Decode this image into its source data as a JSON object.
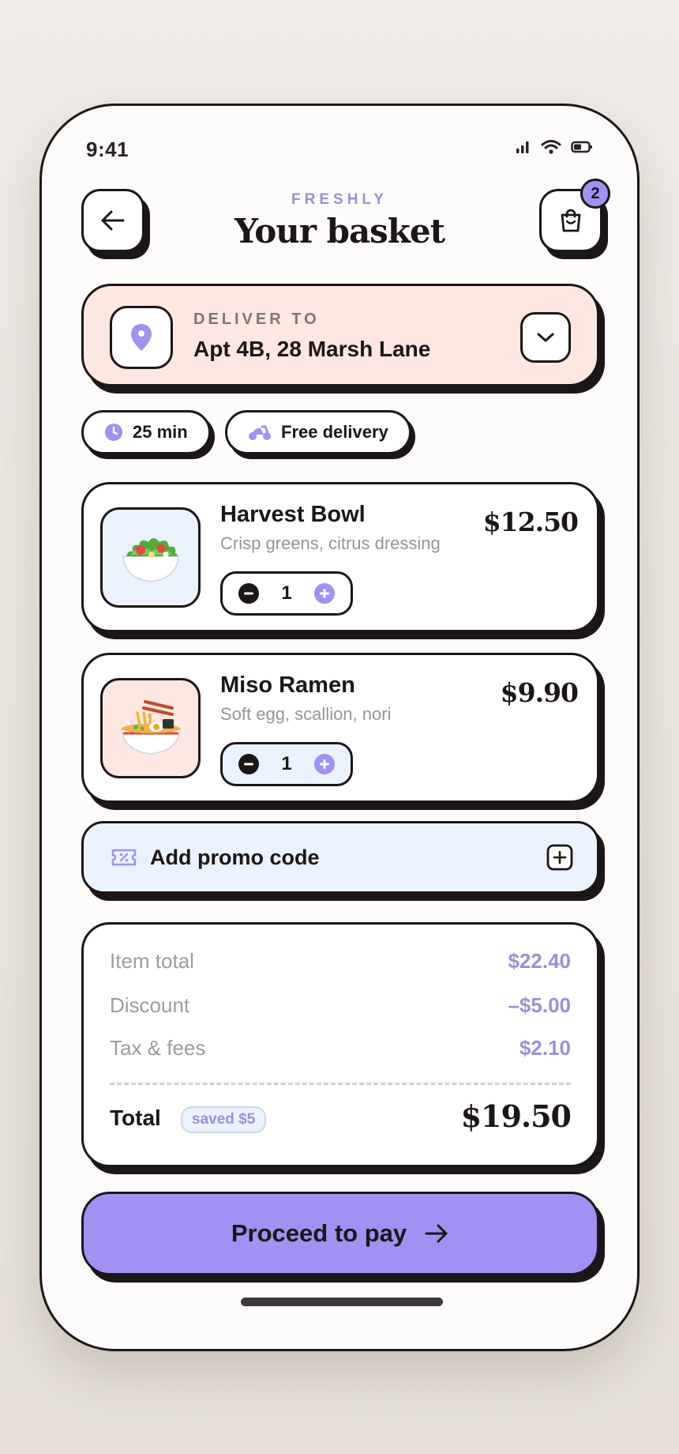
{
  "status_bar": {
    "time": "9:41"
  },
  "header": {
    "brand": "FRESHLY",
    "title": "Your basket",
    "cart_count": "2"
  },
  "delivery": {
    "label": "DELIVER TO",
    "address": "Apt 4B, 28 Marsh Lane"
  },
  "chips": [
    {
      "label": "25 min",
      "icon": "clock-icon"
    },
    {
      "label": "Free delivery",
      "icon": "scooter-icon"
    }
  ],
  "items": [
    {
      "name": "Harvest Bowl",
      "description": "Crisp greens, citrus dressing",
      "price": "$12.50",
      "quantity": "1",
      "icon": "salad-icon",
      "thumb_bg": "#eaf3fd"
    },
    {
      "name": "Miso Ramen",
      "description": "Soft egg, scallion, nori",
      "price": "$9.90",
      "quantity": "1",
      "icon": "ramen-icon",
      "thumb_bg": "#fde7e0"
    }
  ],
  "promo": {
    "label": "Add promo code"
  },
  "summary": {
    "rows": [
      {
        "label": "Item total",
        "value": "$22.40"
      },
      {
        "label": "Discount",
        "value": "–$5.00"
      },
      {
        "label": "Tax & fees",
        "value": "$2.10"
      }
    ],
    "total_label": "Total",
    "saved_badge": "saved $5",
    "total_value": "$19.50"
  },
  "cta": {
    "label": "Proceed to pay"
  },
  "colors": {
    "accent": "#a091f2",
    "ink": "#1d1616",
    "peach": "#fde7e0",
    "sky": "#eaf3fd"
  }
}
